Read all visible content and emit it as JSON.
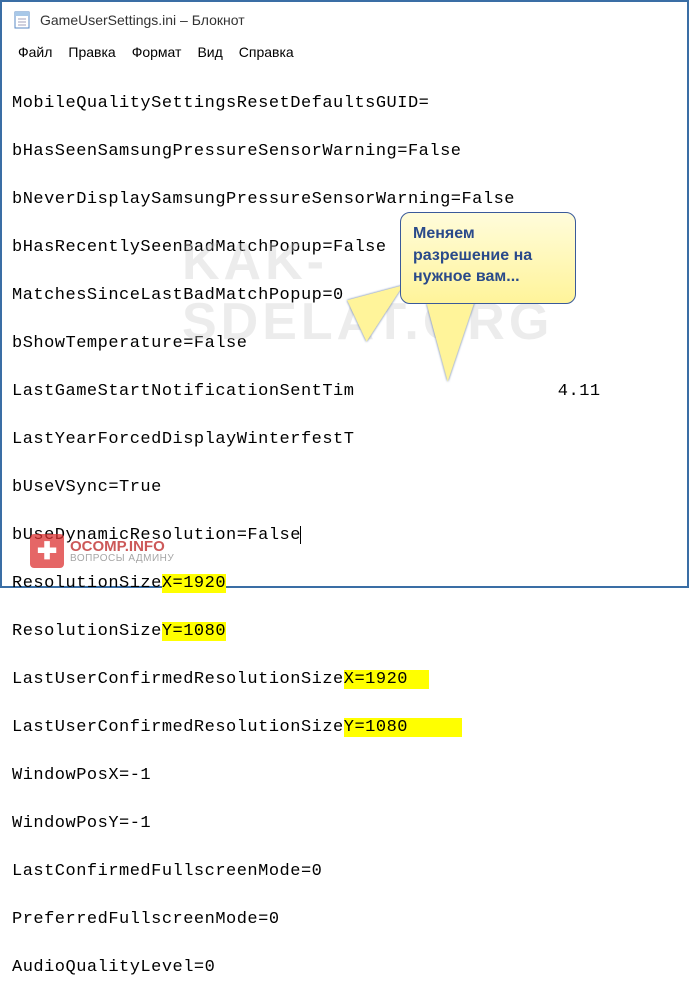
{
  "title": "GameUserSettings.ini – Блокнот",
  "menu": {
    "file": "Файл",
    "edit": "Правка",
    "format": "Формат",
    "view": "Вид",
    "help": "Справка"
  },
  "lines": {
    "l0": "MobileQualitySettingsResetDefaultsGUID=",
    "l1": "bHasSeenSamsungPressureSensorWarning=False",
    "l2": "bNeverDisplaySamsungPressureSensorWarning=False",
    "l3": "bHasRecentlySeenBadMatchPopup=False",
    "l4": "MatchesSinceLastBadMatchPopup=0",
    "l5": "bShowTemperature=False",
    "l6a": "LastGameStartNotificationSentTim",
    "l6b": "4.11",
    "l7": "LastYearForcedDisplayWinterfestT",
    "l8": "bUseVSync=True",
    "l9": "bUseDynamicResolution=False",
    "l10a": "ResolutionSize",
    "l10b": "X=1920",
    "l11a": "ResolutionSize",
    "l11b": "Y=1080",
    "l12a": "LastUserConfirmedResolutionSize",
    "l12b": "X=1920",
    "l13a": "LastUserConfirmedResolutionSize",
    "l13b": "Y=1080",
    "l14": "WindowPosX=-1",
    "l15": "WindowPosY=-1",
    "l16": "LastConfirmedFullscreenMode=0",
    "l17": "PreferredFullscreenMode=0",
    "l18": "AudioQualityLevel=0"
  },
  "callout": "Меняем разрешение на нужное вам...",
  "watermark": "KAK-SDELAT.ORG",
  "logo": {
    "top": "OCOMP.INFO",
    "bot": "ВОПРОСЫ АДМИНУ"
  }
}
